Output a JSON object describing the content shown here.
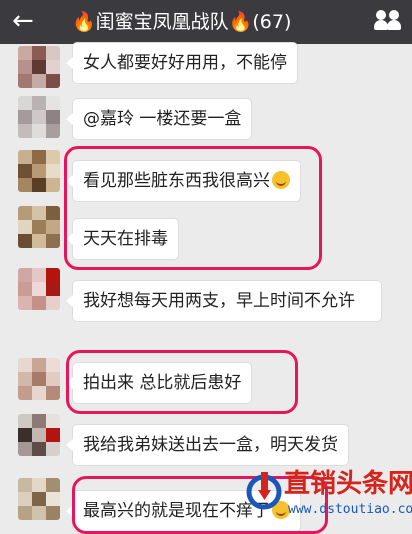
{
  "header": {
    "back_icon": "arrow-left-icon",
    "title_prefix": "🔥",
    "title": "闺蜜宝凤凰战队",
    "title_suffix": "🔥",
    "member_count": "(67)",
    "members_icon": "group-members-icon"
  },
  "messages": [
    {
      "text": "女人都要好好用用，不能停"
    },
    {
      "text": "@嘉玲 一楼还要一盒"
    },
    {
      "text": "看见那些脏东西我很高兴",
      "emoji": "grinning-face-icon"
    },
    {
      "text": "天天在排毒"
    },
    {
      "text": "我好想每天用两支，早上时间不允许"
    },
    {
      "text": "拍出来  总比就后患好"
    },
    {
      "text": "我给我弟妹送出去一盒，明天发货"
    },
    {
      "text": "最高兴的就是现在不痒了",
      "emoji": "laughing-face-icon"
    }
  ],
  "watermark": {
    "name": "直销头条网",
    "url": "www.dstoutiao.com"
  },
  "colors": {
    "header_bg": "#3a3a3f",
    "chat_bg": "#ebebeb",
    "highlight": "#e3175e"
  }
}
